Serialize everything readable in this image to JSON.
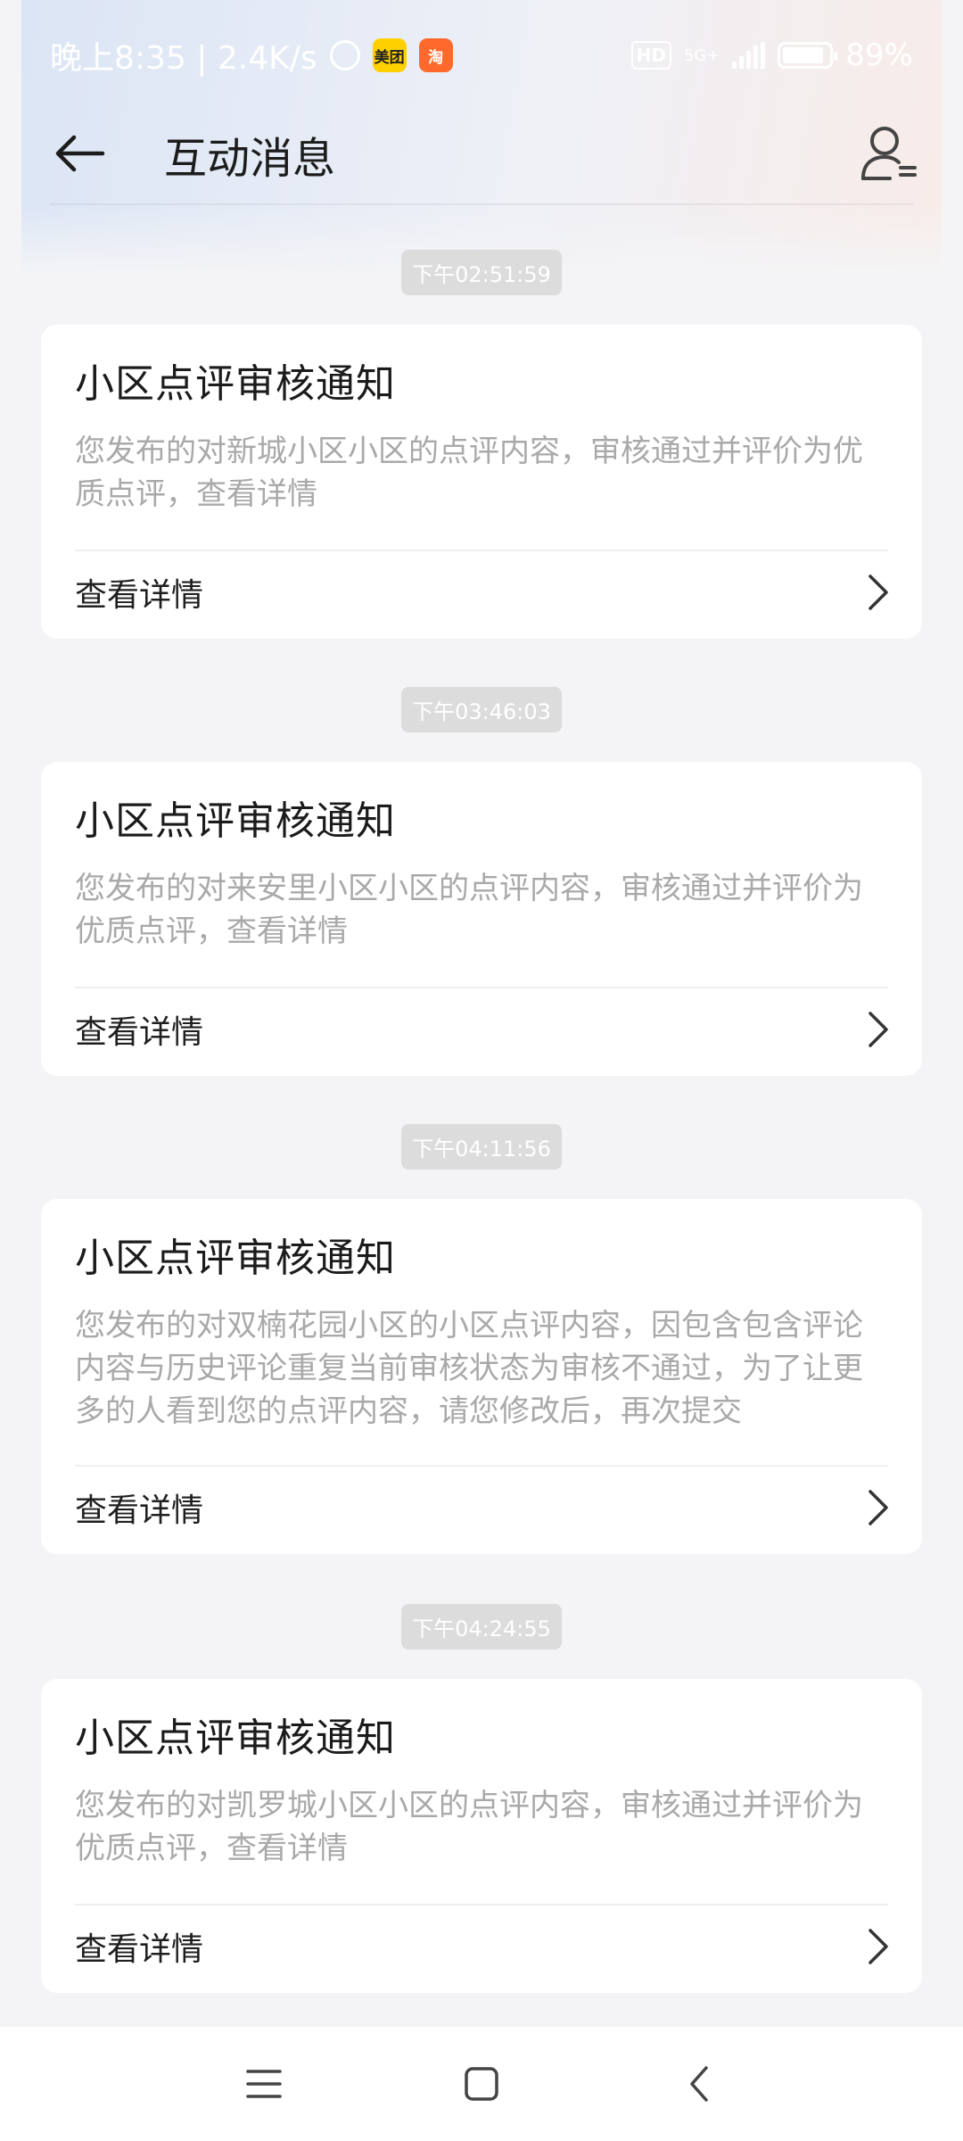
{
  "status_bar": {
    "time_text": "晚上8:35 | 2.4K/s",
    "meituan_label": "美团",
    "taobao_label": "淘",
    "hd_label": "HD",
    "network_label": "5G+",
    "battery_text": "89%",
    "battery_level": 0.89
  },
  "header": {
    "title": "互动消息",
    "back_icon": "arrow-left-icon",
    "user_icon": "user-menu-icon"
  },
  "messages": [
    {
      "time": "下午02:51:59",
      "title": "小区点评审核通知",
      "body": "您发布的对新城小区小区的点评内容，审核通过并评价为优质点评，查看详情",
      "link_label": "查看详情"
    },
    {
      "time": "下午03:46:03",
      "title": "小区点评审核通知",
      "body": "您发布的对来安里小区小区的点评内容，审核通过并评价为优质点评，查看详情",
      "link_label": "查看详情"
    },
    {
      "time": "下午04:11:56",
      "title": "小区点评审核通知",
      "body": "您发布的对双楠花园小区的小区点评内容，因包含包含评论内容与历史评论重复当前审核状态为审核不通过，为了让更多的人看到您的点评内容，请您修改后，再次提交",
      "link_label": "查看详情"
    },
    {
      "time": "下午04:24:55",
      "title": "小区点评审核通知",
      "body": "您发布的对凯罗城小区小区的点评内容，审核通过并评价为优质点评，查看详情",
      "link_label": "查看详情"
    }
  ],
  "nav": {
    "menu_icon": "menu-icon",
    "home_icon": "home-icon",
    "back_icon": "back-icon"
  }
}
